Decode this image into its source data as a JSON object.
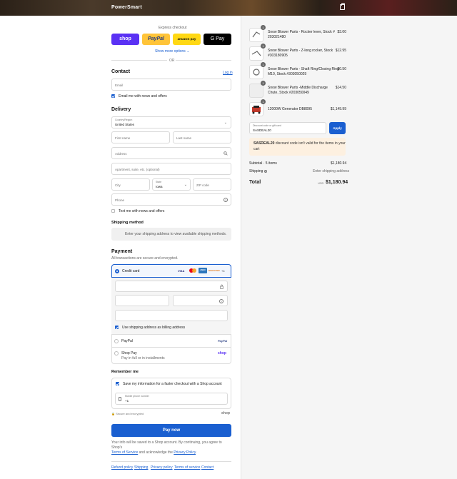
{
  "store": {
    "name": "PowerSmart"
  },
  "express": {
    "title": "Express checkout",
    "shop": "shop",
    "paypal": "PayPal",
    "amazon": "amazon pay",
    "gpay": "G Pay",
    "more": "Show more options ⌄",
    "or": "OR"
  },
  "contact": {
    "title": "Contact",
    "login": "Log in",
    "email_ph": "Email",
    "news": "Email me with news and offers"
  },
  "delivery": {
    "title": "Delivery",
    "country_label": "Country/Region",
    "country": "United States",
    "first": "First name",
    "last": "Last name",
    "address": "Address",
    "apt": "Apartment, suite, etc. (optional)",
    "city": "City",
    "state_label": "State",
    "state": "Iowa",
    "zip": "ZIP code",
    "phone": "Phone",
    "text_news": "Text me with news and offers"
  },
  "shipping": {
    "title": "Shipping method",
    "msg": "Enter your shipping address to view available shipping methods."
  },
  "payment": {
    "title": "Payment",
    "sub": "All transactions are secure and encrypted.",
    "card": "Credit card",
    "visa": "VISA",
    "amex": "AMEX",
    "discover": "DISCOVER",
    "more_cards": "+4",
    "billing": "Use shipping address as billing address",
    "paypal": "PayPal",
    "paypal_logo": "PayPal",
    "shoppay": "Shop Pay",
    "shoppay_sub": "Pay in full or in installments",
    "shoppay_logo": "shop"
  },
  "remember": {
    "title": "Remember me",
    "save": "Save my information for a faster checkout with a Shop account",
    "mobile_label": "Mobile phone number",
    "mobile": "+1",
    "secure": "Secure and encrypted",
    "shop": "shop"
  },
  "pay": {
    "button": "Pay now",
    "info1": "Your info will be saved to a Shop account. By continuing, you agree to Shop's",
    "terms": "Terms of Service",
    "and": " and acknowledge the ",
    "privacy": "Privacy Policy",
    "dot": "."
  },
  "footer": {
    "refund": "Refund policy",
    "ship": "Shipping",
    "privacy": "Privacy policy",
    "terms": "Terms of service",
    "contact": "Contact"
  },
  "cart": {
    "items": [
      {
        "qty": "1",
        "name": "Snow Blower Parts - Rocker lever, Stock #",
        "name2": "203021480",
        "price": "$3.00"
      },
      {
        "qty": "1",
        "name": "Snow Blower Parts - Z-long rocker, Stock",
        "name2": "#303180905",
        "price": "$12.95"
      },
      {
        "qty": "1",
        "name": "Snow Blower Parts - Shaft Ring/Closing Ring",
        "name2": "M10, Stock #303050029",
        "price": "$0.50"
      },
      {
        "qty": "1",
        "name": "Snow Blower Parts -Middle Discharge",
        "name2": "Chute, Stock #203050049",
        "price": "$14.50"
      },
      {
        "qty": "1",
        "name": "12000W Generator DB8095",
        "name2": "",
        "price": "$1,149.99"
      }
    ],
    "discount_label": "Discount code or gift card",
    "discount_value": "SASDEAL20",
    "apply": "Apply",
    "error_code": "SASDEAL20",
    "error_msg": " discount code isn't valid for the items in your",
    "error_msg2": "cart",
    "subtotal_label": "Subtotal · 5 items",
    "subtotal": "$1,180.94",
    "shipping_label": "Shipping",
    "shipping_val": "Enter shipping address",
    "total_label": "Total",
    "currency": "USD",
    "total": "$1,180.94"
  },
  "colors": {
    "accent": "#1a5fd0",
    "shop": "#5a31f4",
    "paypal": "#ffc439",
    "amazon": "#ffd814"
  }
}
